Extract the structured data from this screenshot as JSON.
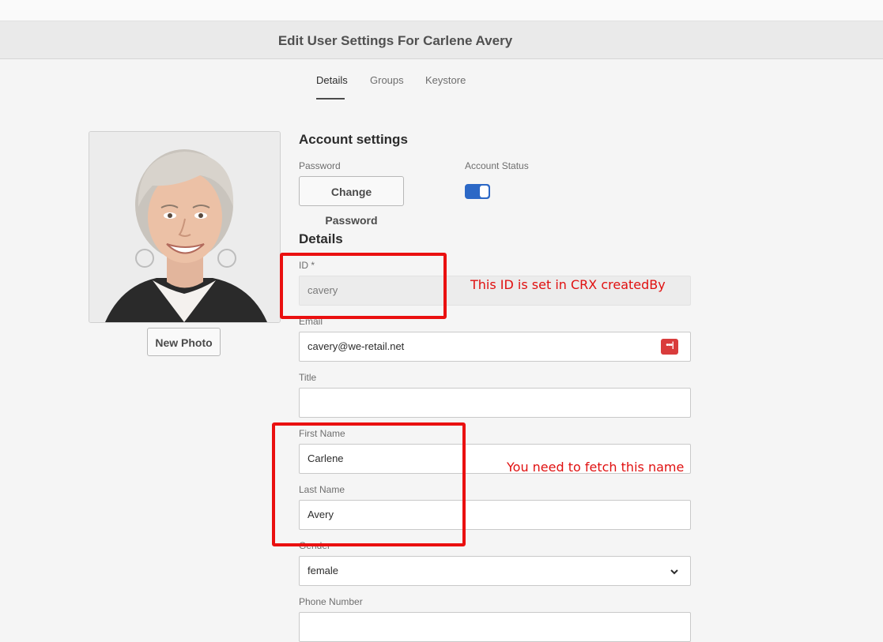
{
  "header": {
    "title": "Edit User Settings For Carlene Avery"
  },
  "tabs": [
    {
      "label": "Details",
      "selected": true
    },
    {
      "label": "Groups",
      "selected": false
    },
    {
      "label": "Keystore",
      "selected": false
    }
  ],
  "profile": {
    "new_photo_label": "New Photo"
  },
  "account": {
    "section_title": "Account settings",
    "password_label": "Password",
    "change_password_label": "Change Password",
    "status_label": "Account Status",
    "status_enabled": true
  },
  "details": {
    "section_title": "Details",
    "id_label": "ID *",
    "id_value": "cavery",
    "email_label": "Email",
    "email_value": "cavery@we-retail.net",
    "title_label": "Title",
    "title_value": "",
    "first_name_label": "First Name",
    "first_name_value": "Carlene",
    "last_name_label": "Last Name",
    "last_name_value": "Avery",
    "gender_label": "Gender",
    "gender_value": "female",
    "phone_label": "Phone Number",
    "phone_value": ""
  },
  "annotations": {
    "id_note": "This ID is set in CRX createdBy",
    "name_note": "You need to fetch this name",
    "color": "#ea1010"
  },
  "colors": {
    "toggle_on": "#2c68c6",
    "password_manager": "#d93c3c"
  }
}
